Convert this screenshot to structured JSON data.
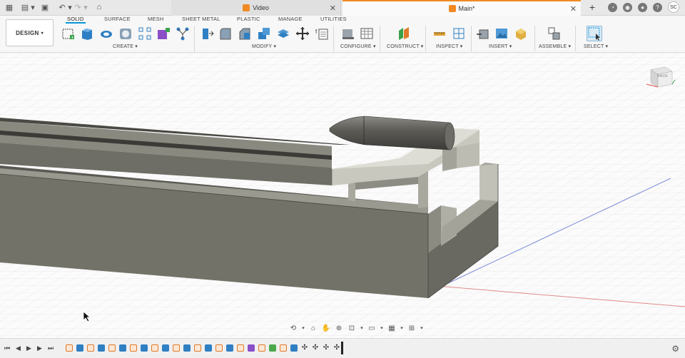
{
  "topbar": {
    "tabs": [
      {
        "label": "Video",
        "active": false
      },
      {
        "label": "Main*",
        "active": true
      }
    ],
    "avatar": "SC"
  },
  "toolbar": {
    "design_label": "DESIGN",
    "workspace_tabs": [
      "SOLID",
      "SURFACE",
      "MESH",
      "SHEET METAL",
      "PLASTIC",
      "MANAGE",
      "UTILITIES"
    ],
    "groups": [
      "CREATE",
      "MODIFY",
      "CONFIGURE",
      "CONSTRUCT",
      "INSPECT",
      "INSERT",
      "ASSEMBLE",
      "SELECT"
    ]
  },
  "viewcube": {
    "face_label": "BACK"
  },
  "colors": {
    "accent": "#0696d7",
    "orange": "#f08a24",
    "model": "#7a7a72"
  }
}
